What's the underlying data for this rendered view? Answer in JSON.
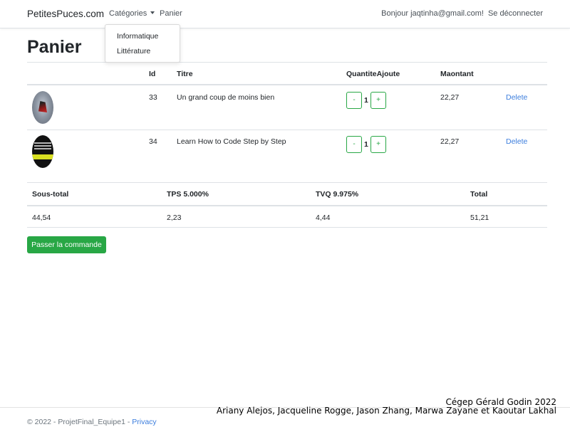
{
  "navbar": {
    "brand": "PetitesPuces.com",
    "categories_label": "Catégories",
    "cart_label": "Panier",
    "greeting": "Bonjour jaqtinha@gmail.com!",
    "logout_label": "Se déconnecter"
  },
  "categories_menu": {
    "items": [
      "Informatique",
      "Littérature"
    ]
  },
  "page": {
    "title": "Panier"
  },
  "cart": {
    "headers": {
      "image": "",
      "id": "Id",
      "title": "Titre",
      "qty": "QuantiteAjoute",
      "amount": "Maontant"
    },
    "items": [
      {
        "id": "33",
        "title": "Un grand coup de moins bien",
        "qty": "1",
        "amount": "22,27",
        "minus": "-",
        "plus": "+",
        "delete": "Delete"
      },
      {
        "id": "34",
        "title": "Learn How to Code Step by Step",
        "qty": "1",
        "amount": "22,27",
        "minus": "-",
        "plus": "+",
        "delete": "Delete"
      }
    ]
  },
  "totals": {
    "headers": [
      "Sous-total",
      "TPS 5.000%",
      "TVQ 9.975%",
      "Total"
    ],
    "values": [
      "44,54",
      "2,23",
      "4,44",
      "51,21"
    ]
  },
  "order_button": "Passer la commande",
  "footer": {
    "copyright": "© 2022 - ProjetFinal_Equipe1 -",
    "privacy": "Privacy"
  },
  "credits": {
    "line1": "Cégep Gérald Godin 2022",
    "line2": "Ariany Alejos, Jacqueline Rogge, Jason Zhang, Marwa Zayane et Kaoutar Lakhal"
  },
  "colors": {
    "success": "#28a745",
    "link": "#3b7ddd",
    "border": "#dee2e6"
  }
}
